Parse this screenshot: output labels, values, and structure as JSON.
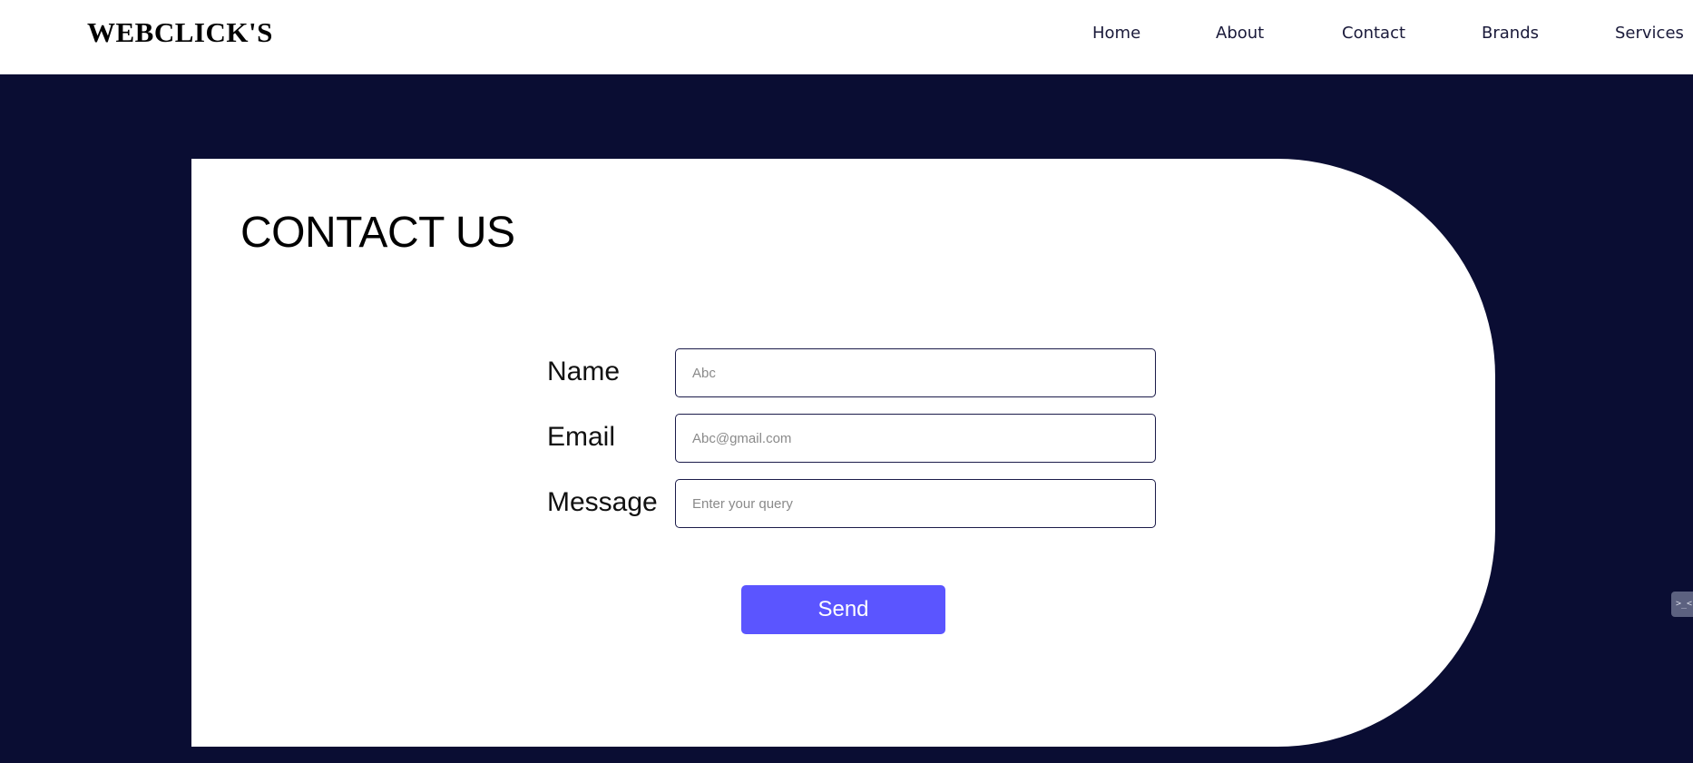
{
  "header": {
    "brand": "WEBCLICK'S",
    "nav": [
      "Home",
      "About",
      "Contact",
      "Brands",
      "Services"
    ]
  },
  "contact": {
    "title": "CONTACT US",
    "fields": [
      {
        "label": "Name",
        "placeholder": "Abc"
      },
      {
        "label": "Email",
        "placeholder": "Abc@gmail.com"
      },
      {
        "label": "Message",
        "placeholder": "Enter your query"
      }
    ],
    "send_label": "Send"
  },
  "widget": {
    "icon": "code-icon",
    "glyph": ">_<"
  },
  "colors": {
    "page_background": "#0a0d33",
    "card_background": "#ffffff",
    "send_button": "#5b55ff",
    "input_border": "#1c1c4a"
  }
}
